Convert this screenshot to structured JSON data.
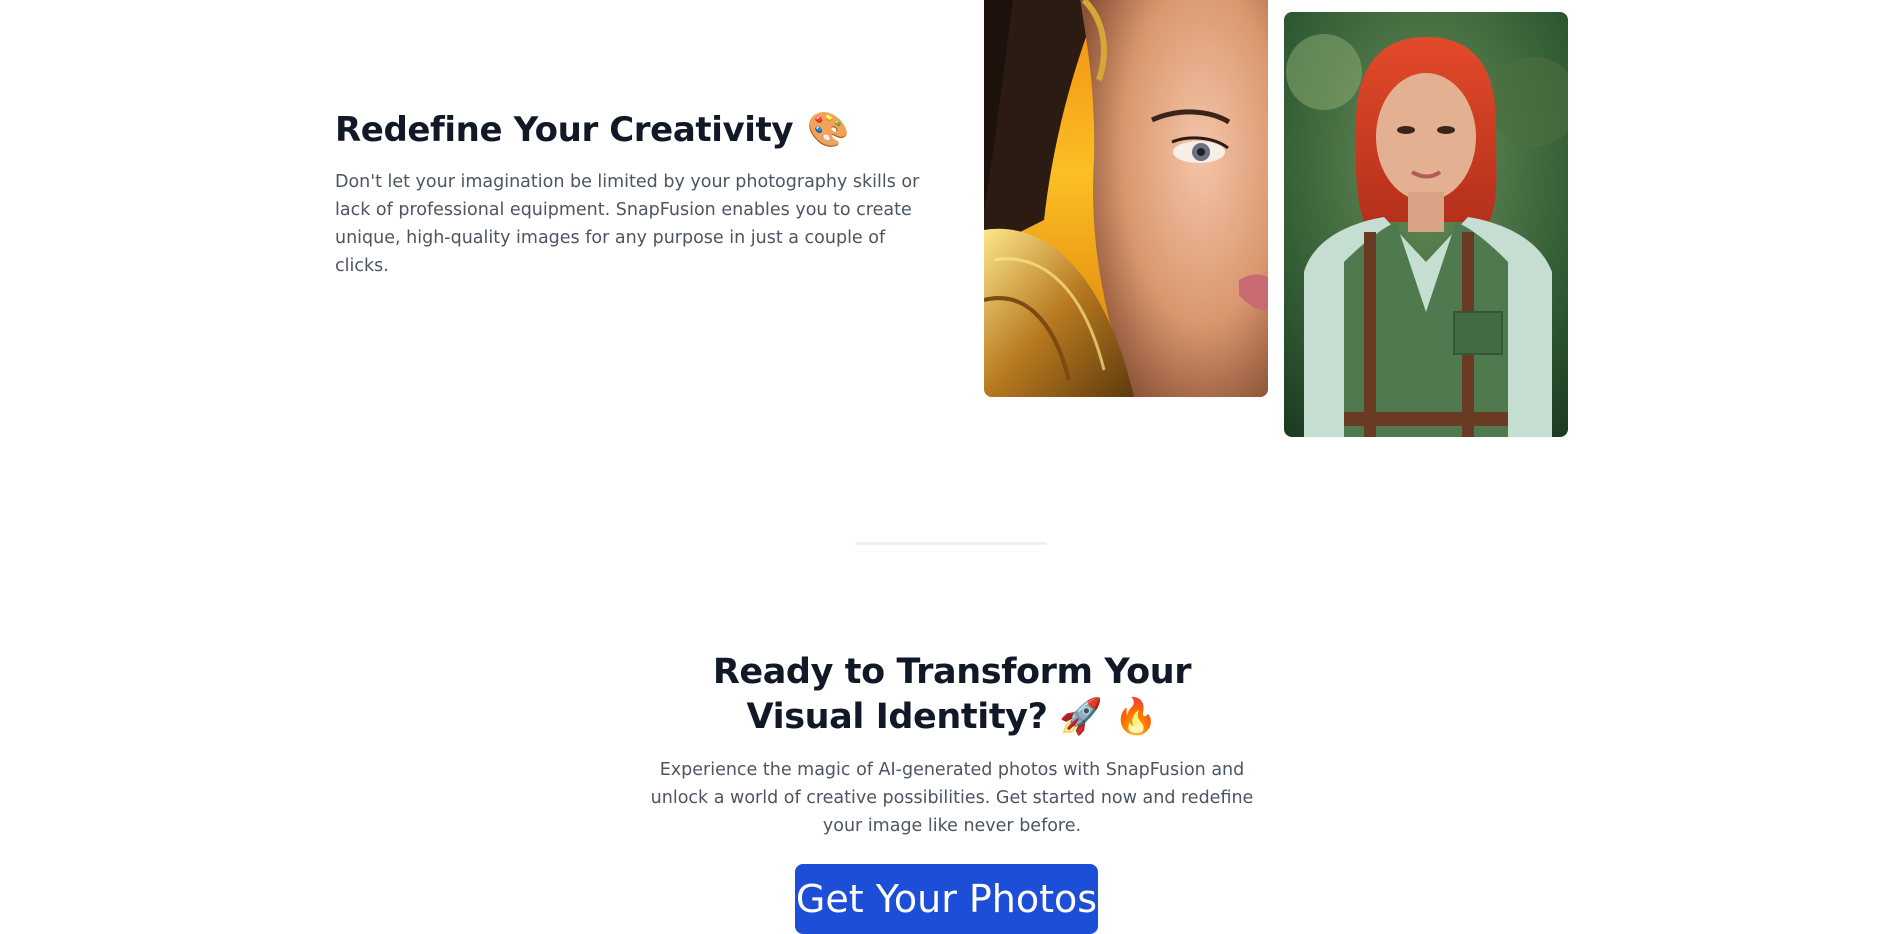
{
  "creativity": {
    "title": "Redefine Your Creativity",
    "emoji": "🎨",
    "description": "Don't let your imagination be limited by your photography skills or lack of professional equipment. SnapFusion enables you to create unique, high-quality images for any purpose in just a couple of clicks."
  },
  "cta": {
    "title": "Ready to Transform Your Visual Identity?",
    "emoji_rocket": "🚀",
    "emoji_fire": "🔥",
    "description": "Experience the magic of AI-generated photos with SnapFusion and unlock a world of creative possibilities. Get started now and redefine your image like never before.",
    "button_label": "Get Your Photos"
  },
  "colors": {
    "heading": "#111827",
    "body_text": "#4b5563",
    "button": "#1d4ed8"
  }
}
